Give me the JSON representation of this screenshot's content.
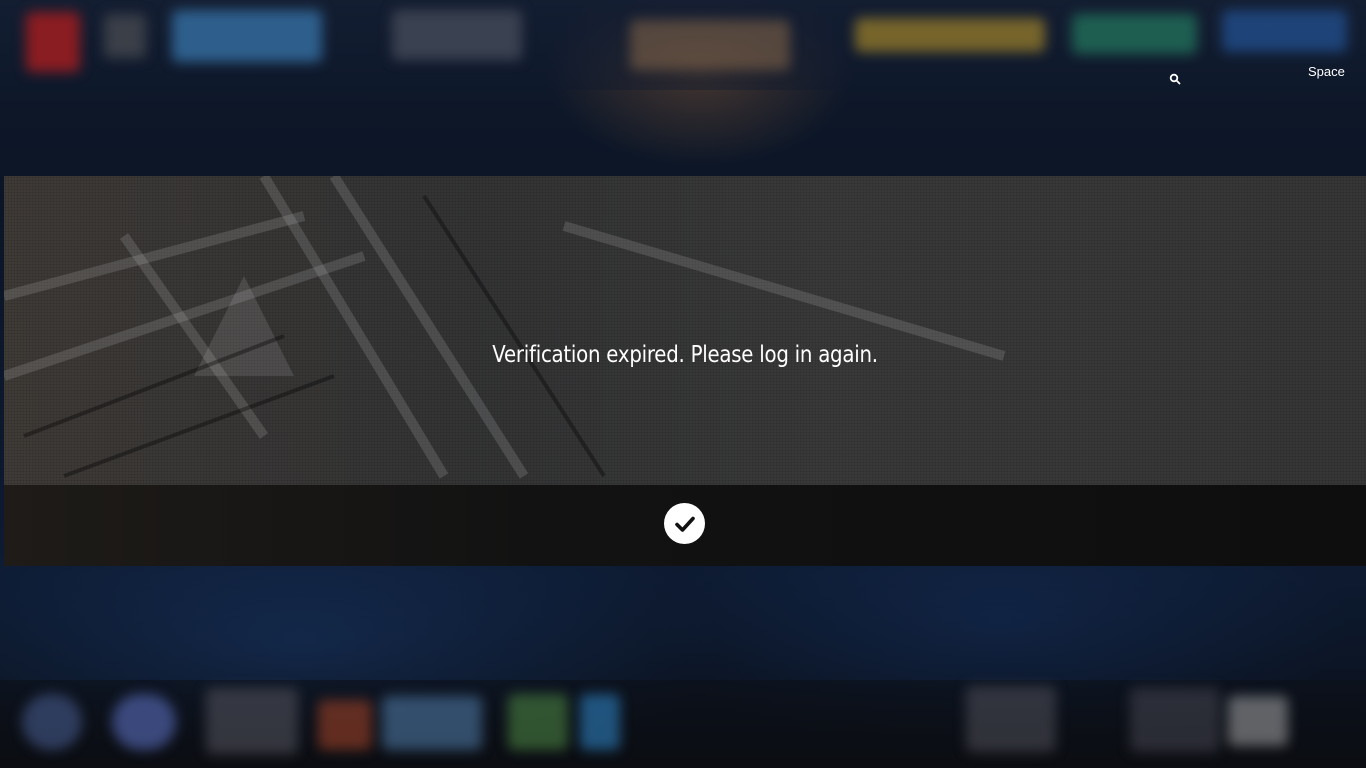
{
  "header": {
    "space_label": "Space",
    "search_icon": "search-icon"
  },
  "dialog": {
    "message": "Verification expired. Please log in again.",
    "confirm_icon": "check-icon"
  },
  "colors": {
    "dialog_body": "#3b3b3b",
    "dialog_footer": "#0e0e0e",
    "confirm_button": "#ffffff",
    "text": "#ffffff"
  }
}
